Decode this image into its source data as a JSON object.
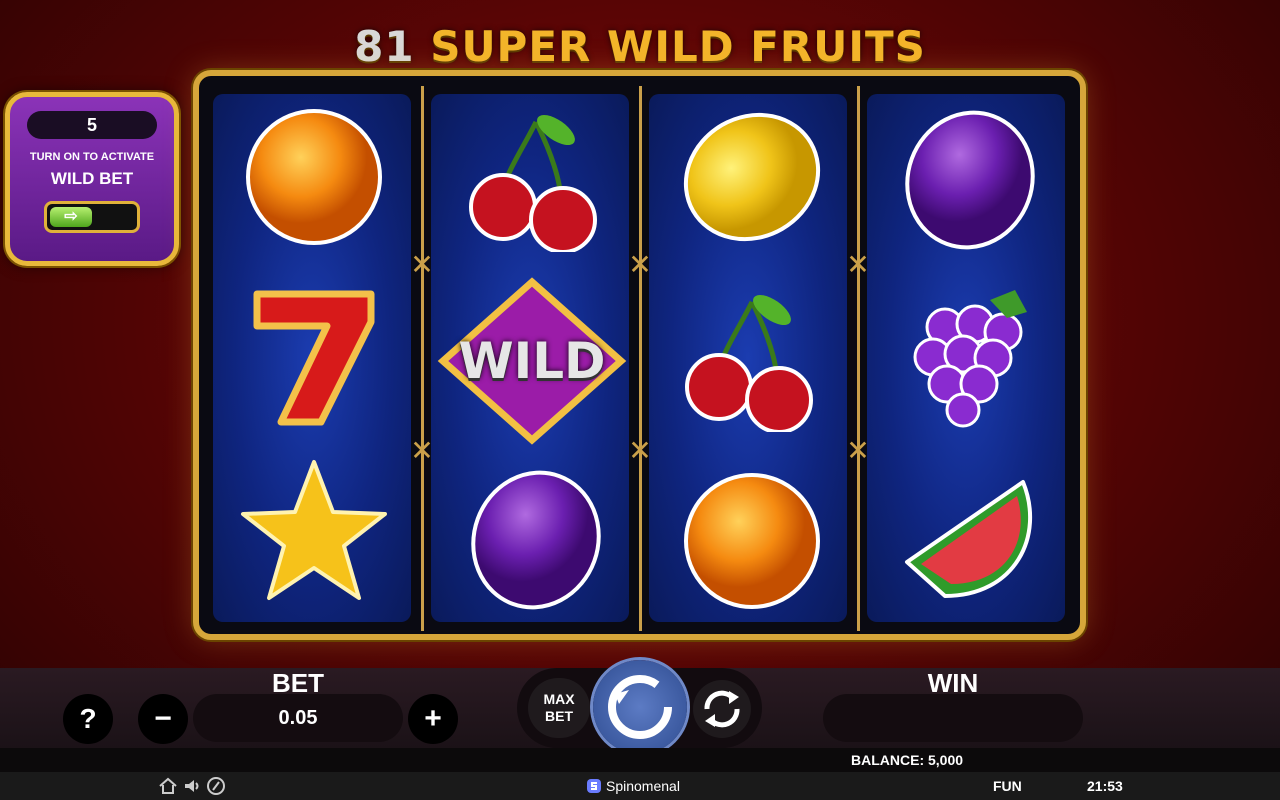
{
  "title": {
    "number": "81",
    "text": "SUPER WILD FRUITS"
  },
  "wild_bet": {
    "count": "5",
    "hint": "TURN ON TO ACTIVATE",
    "label": "WILD BET",
    "toggle_state": "off"
  },
  "reels": [
    [
      "orange",
      "seven",
      "star"
    ],
    [
      "cherry",
      "wild",
      "plum"
    ],
    [
      "lemon",
      "cherry",
      "orange"
    ],
    [
      "plum",
      "grapes",
      "watermelon"
    ]
  ],
  "wild_symbol_text": "WILD",
  "controls": {
    "help_label": "?",
    "bet_label": "BET",
    "bet_value": "0.05",
    "minus_label": "−",
    "plus_label": "+",
    "maxbet_line1": "MAX",
    "maxbet_line2": "BET",
    "win_label": "WIN",
    "win_value": ""
  },
  "balance": "BALANCE: 5,000",
  "footer": {
    "brand": "Spinomenal",
    "mode": "FUN",
    "clock": "21:53",
    "icons": [
      "home-icon",
      "sound-icon",
      "turbo-icon"
    ]
  },
  "colors": {
    "gold": "#d6a63a",
    "reel_blue": "#1b3cb0",
    "spin_blue": "#3c5aa0",
    "panel_purple": "#8b33b8"
  }
}
